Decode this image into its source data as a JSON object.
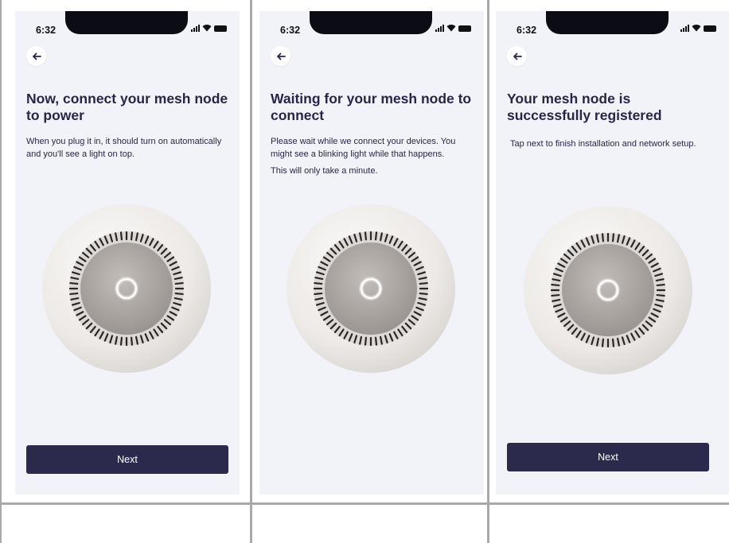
{
  "caption": "",
  "screens": [
    {
      "time": "6:32",
      "title": "Now, connect your mesh node to power",
      "paragraphs": [
        "When you plug it in, it should turn on automatically and you'll see a light on top."
      ],
      "next_label": "Next"
    },
    {
      "time": "6:32",
      "title": "Waiting for your mesh node to connect",
      "paragraphs": [
        "Please wait while we connect your devices. You might see a blinking light while that happens.",
        "This will only take a minute."
      ]
    },
    {
      "time": "6:32",
      "title": "Your mesh node is successfully registered",
      "paragraphs": [
        "Tap next to finish installation and network setup."
      ],
      "next_label": "Next"
    }
  ],
  "icons": {
    "back": "arrow-left-icon",
    "signal": "cellular-signal-icon",
    "wifi": "wifi-icon",
    "battery": "battery-icon",
    "device": "mesh-node-image"
  },
  "colors": {
    "screen_background": "#f1f3f8",
    "title_text": "#2a2446",
    "button_background": "#2c2a4c",
    "button_text": "#ffffff",
    "grid_lines": "#a9a9a9"
  }
}
